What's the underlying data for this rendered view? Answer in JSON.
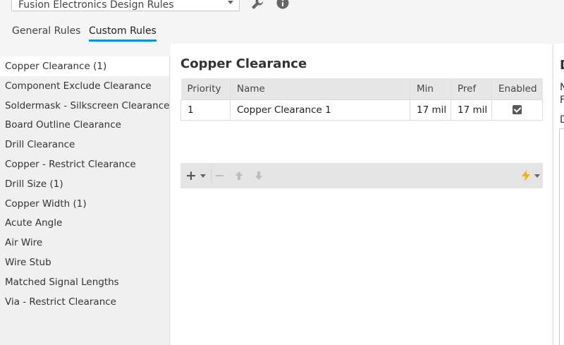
{
  "topbar": {
    "ruleset_select": "Fusion Electronics Design Rules",
    "icons": [
      "wrench-icon",
      "info-icon"
    ]
  },
  "tabs": {
    "general": "General Rules",
    "custom": "Custom Rules",
    "active": "Custom Rules"
  },
  "sidebar": {
    "items": [
      {
        "label": "Copper Clearance (1)",
        "selected": true
      },
      {
        "label": "Component Exclude Clearance"
      },
      {
        "label": "Soldermask - Silkscreen Clearance"
      },
      {
        "label": "Board Outline Clearance"
      },
      {
        "label": "Drill Clearance"
      },
      {
        "label": "Copper - Restrict Clearance"
      },
      {
        "label": "Drill Size (1)"
      },
      {
        "label": "Copper Width (1)"
      },
      {
        "label": "Acute Angle"
      },
      {
        "label": "Air Wire"
      },
      {
        "label": "Wire Stub"
      },
      {
        "label": "Matched Signal Lengths"
      },
      {
        "label": "Via - Restrict Clearance"
      }
    ]
  },
  "main": {
    "title": "Copper Clearance",
    "table": {
      "columns": [
        "Priority",
        "Name",
        "Min",
        "Pref",
        "Enabled"
      ],
      "rows": [
        {
          "priority": "1",
          "name": "Copper Clearance 1",
          "min": "17 mil",
          "pref": "17 mil",
          "enabled": true
        }
      ]
    },
    "toolbar": {
      "add": "+",
      "icons": [
        "add-icon",
        "remove-icon",
        "move-up-icon",
        "move-down-icon",
        "lightning-icon"
      ]
    }
  },
  "right_panel": {
    "title_fragment": "D",
    "line1_fragment": "N",
    "line2_fragment": "F",
    "line3_fragment": "D"
  },
  "colors": {
    "accent": "#0696d7",
    "lightning": "#f0b400"
  }
}
